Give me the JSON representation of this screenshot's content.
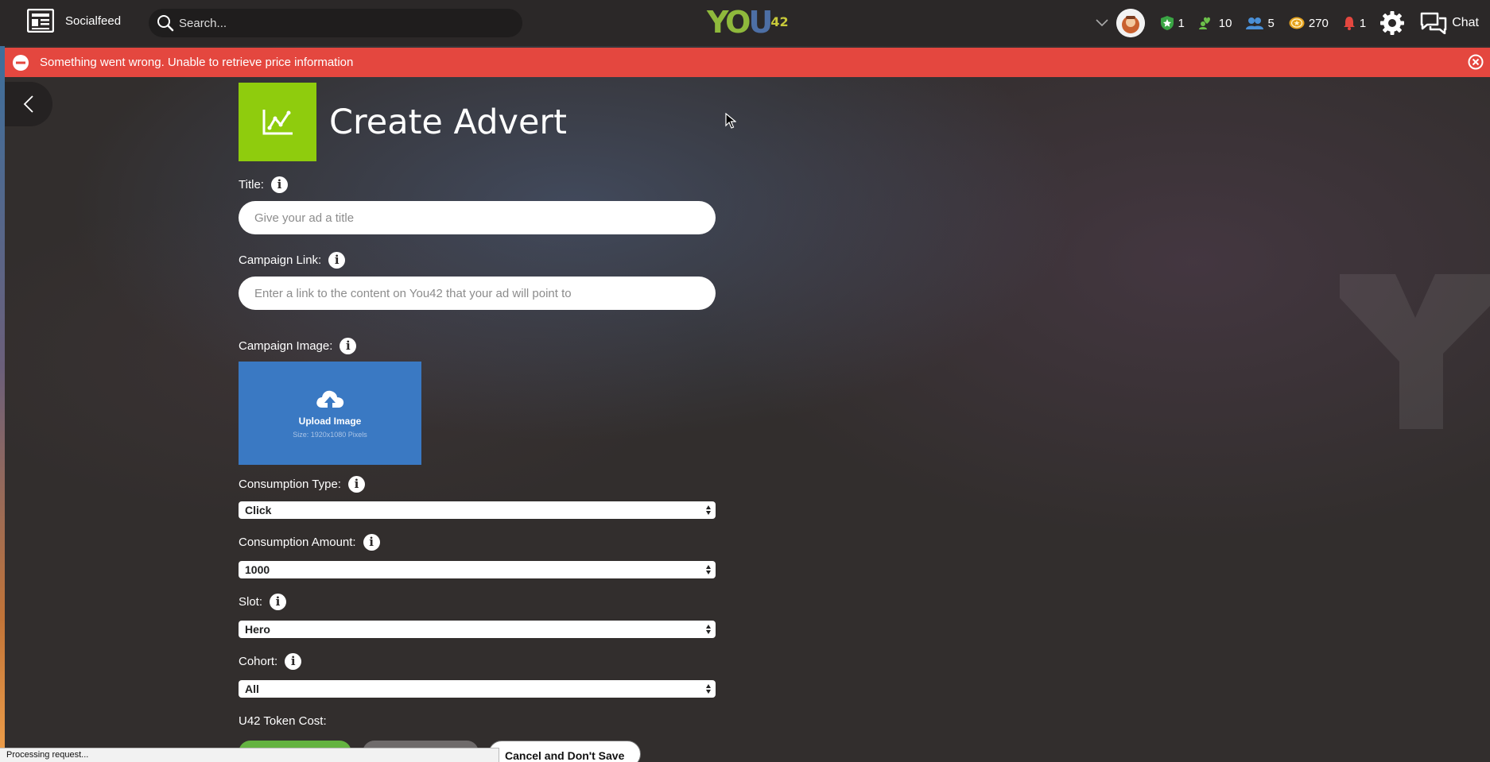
{
  "topbar": {
    "feed_label": "Socialfeed",
    "search_placeholder": "Search...",
    "brand": {
      "y": "YO",
      "o": "U",
      "n": "42"
    },
    "stats": {
      "shield": "1",
      "likes": "10",
      "friends": "5",
      "tokens": "270",
      "alerts": "1"
    },
    "chat_label": "Chat"
  },
  "banner": {
    "message": "Something went wrong. Unable to retrieve price information"
  },
  "form": {
    "title": "Create Advert",
    "title_label": "Title:",
    "title_placeholder": "Give your ad a title",
    "link_label": "Campaign Link:",
    "link_placeholder": "Enter a link to the content on You42 that your ad will point to",
    "image_label": "Campaign Image:",
    "upload_label": "Upload Image",
    "upload_size": "Size: 1920x1080 Pixels",
    "consumption_type_label": "Consumption Type:",
    "consumption_type_value": "Click",
    "consumption_amount_label": "Consumption Amount:",
    "consumption_amount_value": "1000",
    "slot_label": "Slot:",
    "slot_value": "Hero",
    "cohort_label": "Cohort:",
    "cohort_value": "All",
    "token_cost_label": "U42 Token Cost:",
    "cancel_label": "Cancel and Don't Save"
  },
  "status_bar": "Processing request...",
  "colors": {
    "banner": "#e4473f",
    "accent_green": "#8fcc0d",
    "upload_blue": "#3a79c3"
  }
}
